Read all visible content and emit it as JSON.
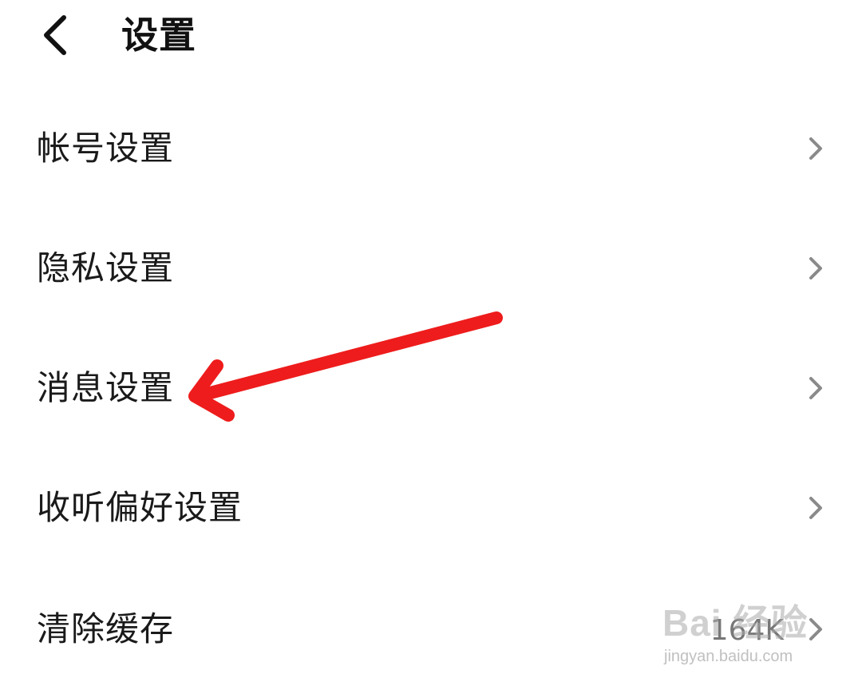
{
  "header": {
    "title": "设置",
    "back_icon": "chevron-left-icon"
  },
  "menu": {
    "items": [
      {
        "label": "帐号设置",
        "value": ""
      },
      {
        "label": "隐私设置",
        "value": ""
      },
      {
        "label": "消息设置",
        "value": ""
      },
      {
        "label": "收听偏好设置",
        "value": ""
      },
      {
        "label": "清除缓存",
        "value": "164K"
      }
    ],
    "chevron_icon": "chevron-right-icon"
  },
  "annotation": {
    "arrow_color": "#ee1c1c",
    "icon": "red-arrow-annotation"
  },
  "watermark": {
    "logo_text": "Bai 经验",
    "url": "jingyan.baidu.com"
  },
  "colors": {
    "background": "#ffffff",
    "text": "#1a1a1a",
    "chevron": "#8a8a8a",
    "arrow": "#ee1c1c"
  }
}
